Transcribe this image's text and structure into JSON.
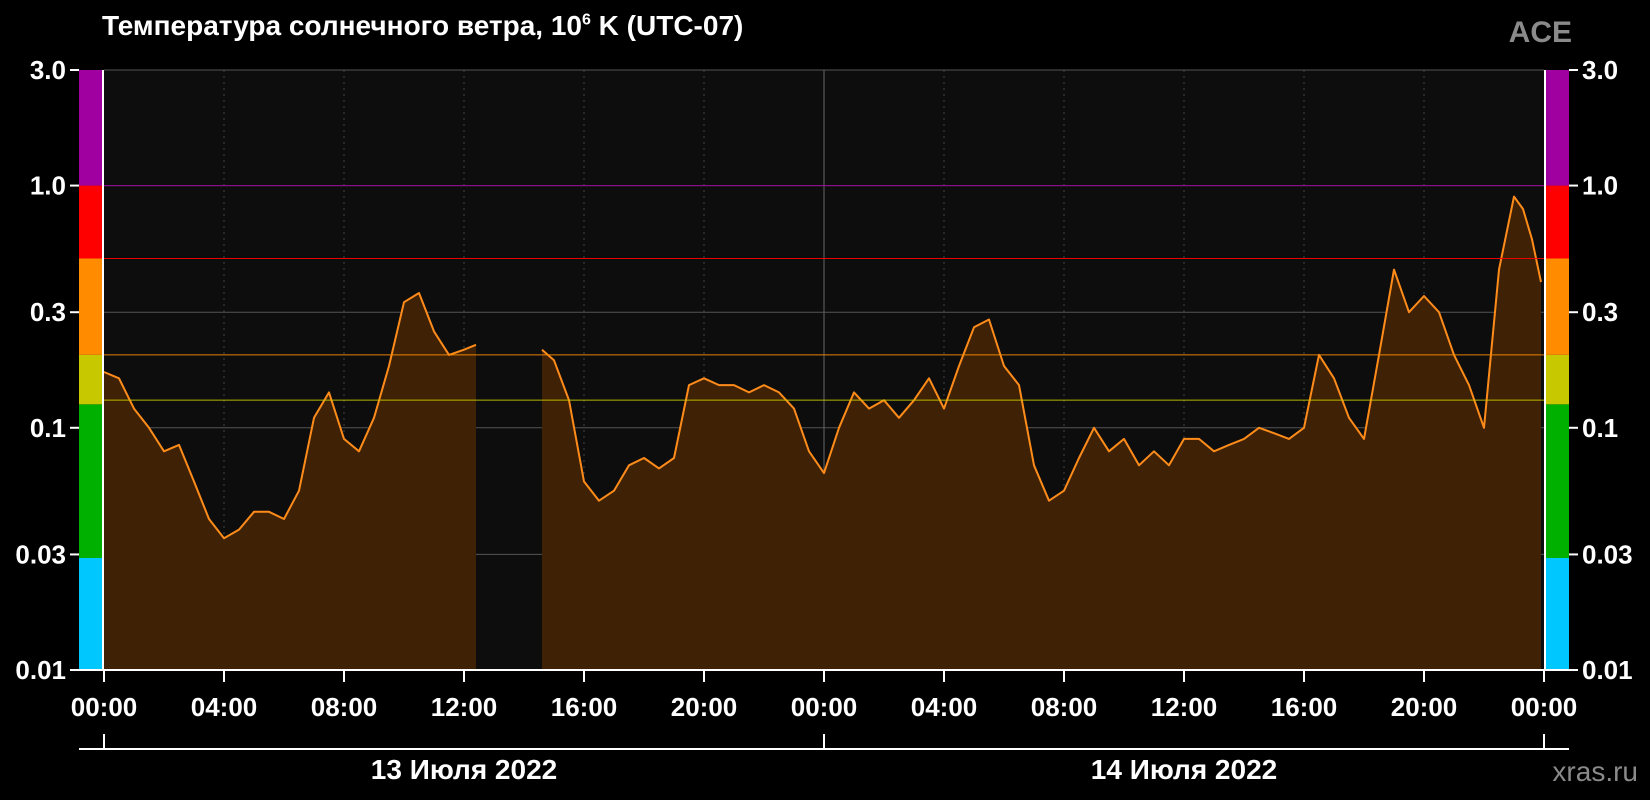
{
  "header": {
    "title_main": "Температура солнечного ветра, 10",
    "title_sup": "6",
    "title_tail": " K (UTC-07)",
    "source": "ACE",
    "site": "xras.ru"
  },
  "colors": {
    "background": "#000000",
    "plot_bg": "#0d0d0d",
    "series_line": "#ff8c1a",
    "series_fill": "#3f2205",
    "grid": "#555555",
    "scale_bands": [
      "#00c8ff",
      "#00b000",
      "#c8c800",
      "#ff8c00",
      "#ff0000",
      "#a000a0"
    ]
  },
  "chart_data": {
    "type": "area",
    "title": "Температура солнечного ветра, 10^6 K (UTC-07)",
    "y_scale": "log",
    "ylim": [
      0.01,
      3.0
    ],
    "yticks": [
      3.0,
      1.0,
      0.3,
      0.1,
      0.03,
      0.01
    ],
    "ytick_labels": [
      "3.0",
      "1.0",
      "0.3",
      "0.1",
      "0.03",
      "0.01"
    ],
    "x_unit": "hours since 13 Jul 2022 00:00 (UTC-07)",
    "xlim": [
      0,
      48
    ],
    "xtick_labels": [
      "00:00",
      "04:00",
      "08:00",
      "12:00",
      "16:00",
      "20:00",
      "00:00",
      "04:00",
      "08:00",
      "12:00",
      "16:00",
      "20:00",
      "00:00"
    ],
    "date_labels": [
      "13 Июля 2022",
      "14 Июля 2022"
    ],
    "thresholds": [
      {
        "value": 1.0,
        "color": "#a000a0"
      },
      {
        "value": 0.5,
        "color": "#ff0000"
      },
      {
        "value": 0.2,
        "color": "#ff8c00"
      },
      {
        "value": 0.13,
        "color": "#c8c800"
      }
    ],
    "scale_bands": [
      {
        "from": 0.01,
        "to": 0.029,
        "color": "#00c8ff"
      },
      {
        "from": 0.029,
        "to": 0.125,
        "color": "#00b000"
      },
      {
        "from": 0.125,
        "to": 0.2,
        "color": "#c8c800"
      },
      {
        "from": 0.2,
        "to": 0.5,
        "color": "#ff8c00"
      },
      {
        "from": 0.5,
        "to": 1.0,
        "color": "#ff0000"
      },
      {
        "from": 1.0,
        "to": 3.0,
        "color": "#a000a0"
      }
    ],
    "series": [
      {
        "values": [
          [
            0.0,
            0.17
          ],
          [
            0.5,
            0.16
          ],
          [
            1.0,
            0.12
          ],
          [
            1.5,
            0.1
          ],
          [
            2.0,
            0.08
          ],
          [
            2.5,
            0.085
          ],
          [
            3.0,
            0.06
          ],
          [
            3.5,
            0.042
          ],
          [
            4.0,
            0.035
          ],
          [
            4.5,
            0.038
          ],
          [
            5.0,
            0.045
          ],
          [
            5.5,
            0.045
          ],
          [
            6.0,
            0.042
          ],
          [
            6.5,
            0.055
          ],
          [
            7.0,
            0.11
          ],
          [
            7.5,
            0.14
          ],
          [
            8.0,
            0.09
          ],
          [
            8.5,
            0.08
          ],
          [
            9.0,
            0.11
          ],
          [
            9.5,
            0.18
          ],
          [
            10.0,
            0.33
          ],
          [
            10.5,
            0.36
          ],
          [
            11.0,
            0.25
          ],
          [
            11.5,
            0.2
          ],
          [
            12.0,
            0.21
          ],
          [
            12.4,
            0.22
          ],
          [
            14.6,
            0.21
          ],
          [
            15.0,
            0.19
          ],
          [
            15.5,
            0.13
          ],
          [
            16.0,
            0.06
          ],
          [
            16.5,
            0.05
          ],
          [
            17.0,
            0.055
          ],
          [
            17.5,
            0.07
          ],
          [
            18.0,
            0.075
          ],
          [
            18.5,
            0.068
          ],
          [
            19.0,
            0.075
          ],
          [
            19.5,
            0.15
          ],
          [
            20.0,
            0.16
          ],
          [
            20.5,
            0.15
          ],
          [
            21.0,
            0.15
          ],
          [
            21.5,
            0.14
          ],
          [
            22.0,
            0.15
          ],
          [
            22.5,
            0.14
          ],
          [
            23.0,
            0.12
          ],
          [
            23.5,
            0.08
          ],
          [
            24.0,
            0.065
          ],
          [
            24.5,
            0.1
          ],
          [
            25.0,
            0.14
          ],
          [
            25.5,
            0.12
          ],
          [
            26.0,
            0.13
          ],
          [
            26.5,
            0.11
          ],
          [
            27.0,
            0.13
          ],
          [
            27.5,
            0.16
          ],
          [
            28.0,
            0.12
          ],
          [
            28.5,
            0.18
          ],
          [
            29.0,
            0.26
          ],
          [
            29.5,
            0.28
          ],
          [
            30.0,
            0.18
          ],
          [
            30.5,
            0.15
          ],
          [
            31.0,
            0.07
          ],
          [
            31.5,
            0.05
          ],
          [
            32.0,
            0.055
          ],
          [
            32.5,
            0.075
          ],
          [
            33.0,
            0.1
          ],
          [
            33.5,
            0.08
          ],
          [
            34.0,
            0.09
          ],
          [
            34.5,
            0.07
          ],
          [
            35.0,
            0.08
          ],
          [
            35.5,
            0.07
          ],
          [
            36.0,
            0.09
          ],
          [
            36.5,
            0.09
          ],
          [
            37.0,
            0.08
          ],
          [
            37.5,
            0.085
          ],
          [
            38.0,
            0.09
          ],
          [
            38.5,
            0.1
          ],
          [
            39.0,
            0.095
          ],
          [
            39.5,
            0.09
          ],
          [
            40.0,
            0.1
          ],
          [
            40.5,
            0.2
          ],
          [
            41.0,
            0.16
          ],
          [
            41.5,
            0.11
          ],
          [
            42.0,
            0.09
          ],
          [
            42.5,
            0.2
          ],
          [
            43.0,
            0.45
          ],
          [
            43.5,
            0.3
          ],
          [
            44.0,
            0.35
          ],
          [
            44.5,
            0.3
          ],
          [
            45.0,
            0.2
          ],
          [
            45.5,
            0.15
          ],
          [
            46.0,
            0.1
          ],
          [
            46.5,
            0.45
          ],
          [
            47.0,
            0.9
          ],
          [
            47.3,
            0.8
          ],
          [
            47.6,
            0.6
          ],
          [
            47.9,
            0.4
          ]
        ]
      }
    ]
  }
}
